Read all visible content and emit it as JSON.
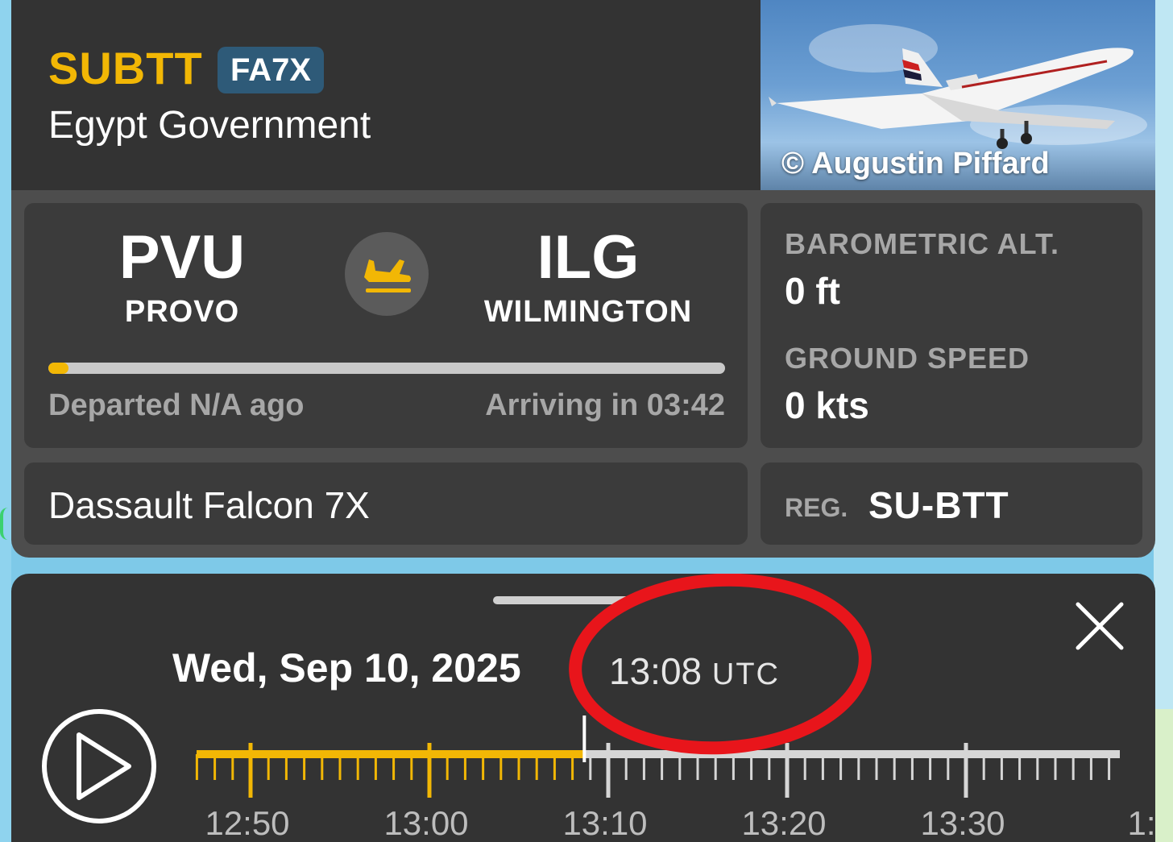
{
  "flight": {
    "callsign": "SUBTT",
    "aircraft_type": "FA7X",
    "operator": "Egypt Government",
    "photo_credit": "© Augustin Piffard"
  },
  "route": {
    "origin_code": "PVU",
    "origin_city": "PROVO",
    "destination_code": "ILG",
    "destination_city": "WILMINGTON",
    "progress": 0.03,
    "departed_text": "Departed N/A ago",
    "arriving_text": "Arriving in 03:42"
  },
  "stats": {
    "altitude_label": "BAROMETRIC ALT.",
    "altitude_value": "0 ft",
    "speed_label": "GROUND SPEED",
    "speed_value": "0 kts"
  },
  "aircraft": {
    "model": "Dassault Falcon 7X",
    "reg_label": "REG.",
    "registration": "SU-BTT"
  },
  "playback": {
    "date": "Wed, Sep 10, 2025",
    "time": "13:08",
    "timezone": "UTC",
    "tick_labels": [
      "12:50",
      "13:00",
      "13:10",
      "13:20",
      "13:30",
      "1:"
    ],
    "played_fraction": 0.42
  },
  "colors": {
    "accent": "#f2b705",
    "badge": "#2e5a78",
    "annotation": "#e8151b"
  }
}
